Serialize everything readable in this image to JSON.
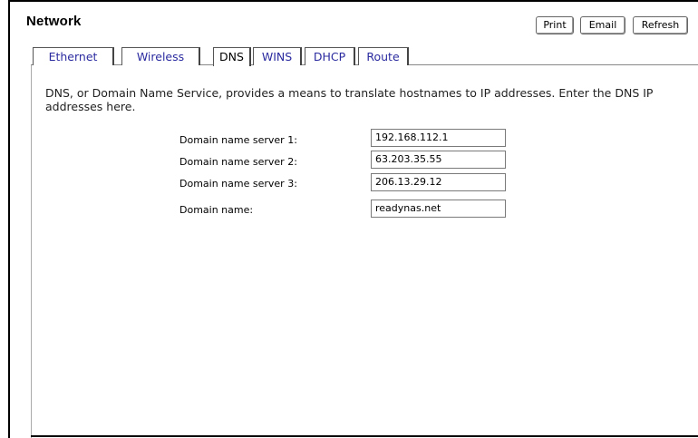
{
  "page": {
    "title": "Network"
  },
  "toolbar": {
    "print_label": "Print",
    "email_label": "Email",
    "refresh_label": "Refresh"
  },
  "tabs": [
    {
      "label": "Ethernet",
      "active": false
    },
    {
      "label": "Wireless",
      "active": false
    },
    {
      "label": "DNS",
      "active": true
    },
    {
      "label": "WINS",
      "active": false
    },
    {
      "label": "DHCP",
      "active": false
    },
    {
      "label": "Route",
      "active": false
    }
  ],
  "dns": {
    "description": "DNS, or Domain Name Service, provides a means to translate hostnames to IP addresses. Enter the DNS IP addresses here.",
    "fields": [
      {
        "label": "Domain name server 1:",
        "value": "192.168.112.1"
      },
      {
        "label": "Domain name server 2:",
        "value": "63.203.35.55"
      },
      {
        "label": "Domain name server 3:",
        "value": "206.13.29.12"
      },
      {
        "label": "Domain name:",
        "value": "readynas.net"
      }
    ]
  },
  "colors": {
    "tab_link": "#2b2ba0",
    "border": "#555555"
  }
}
